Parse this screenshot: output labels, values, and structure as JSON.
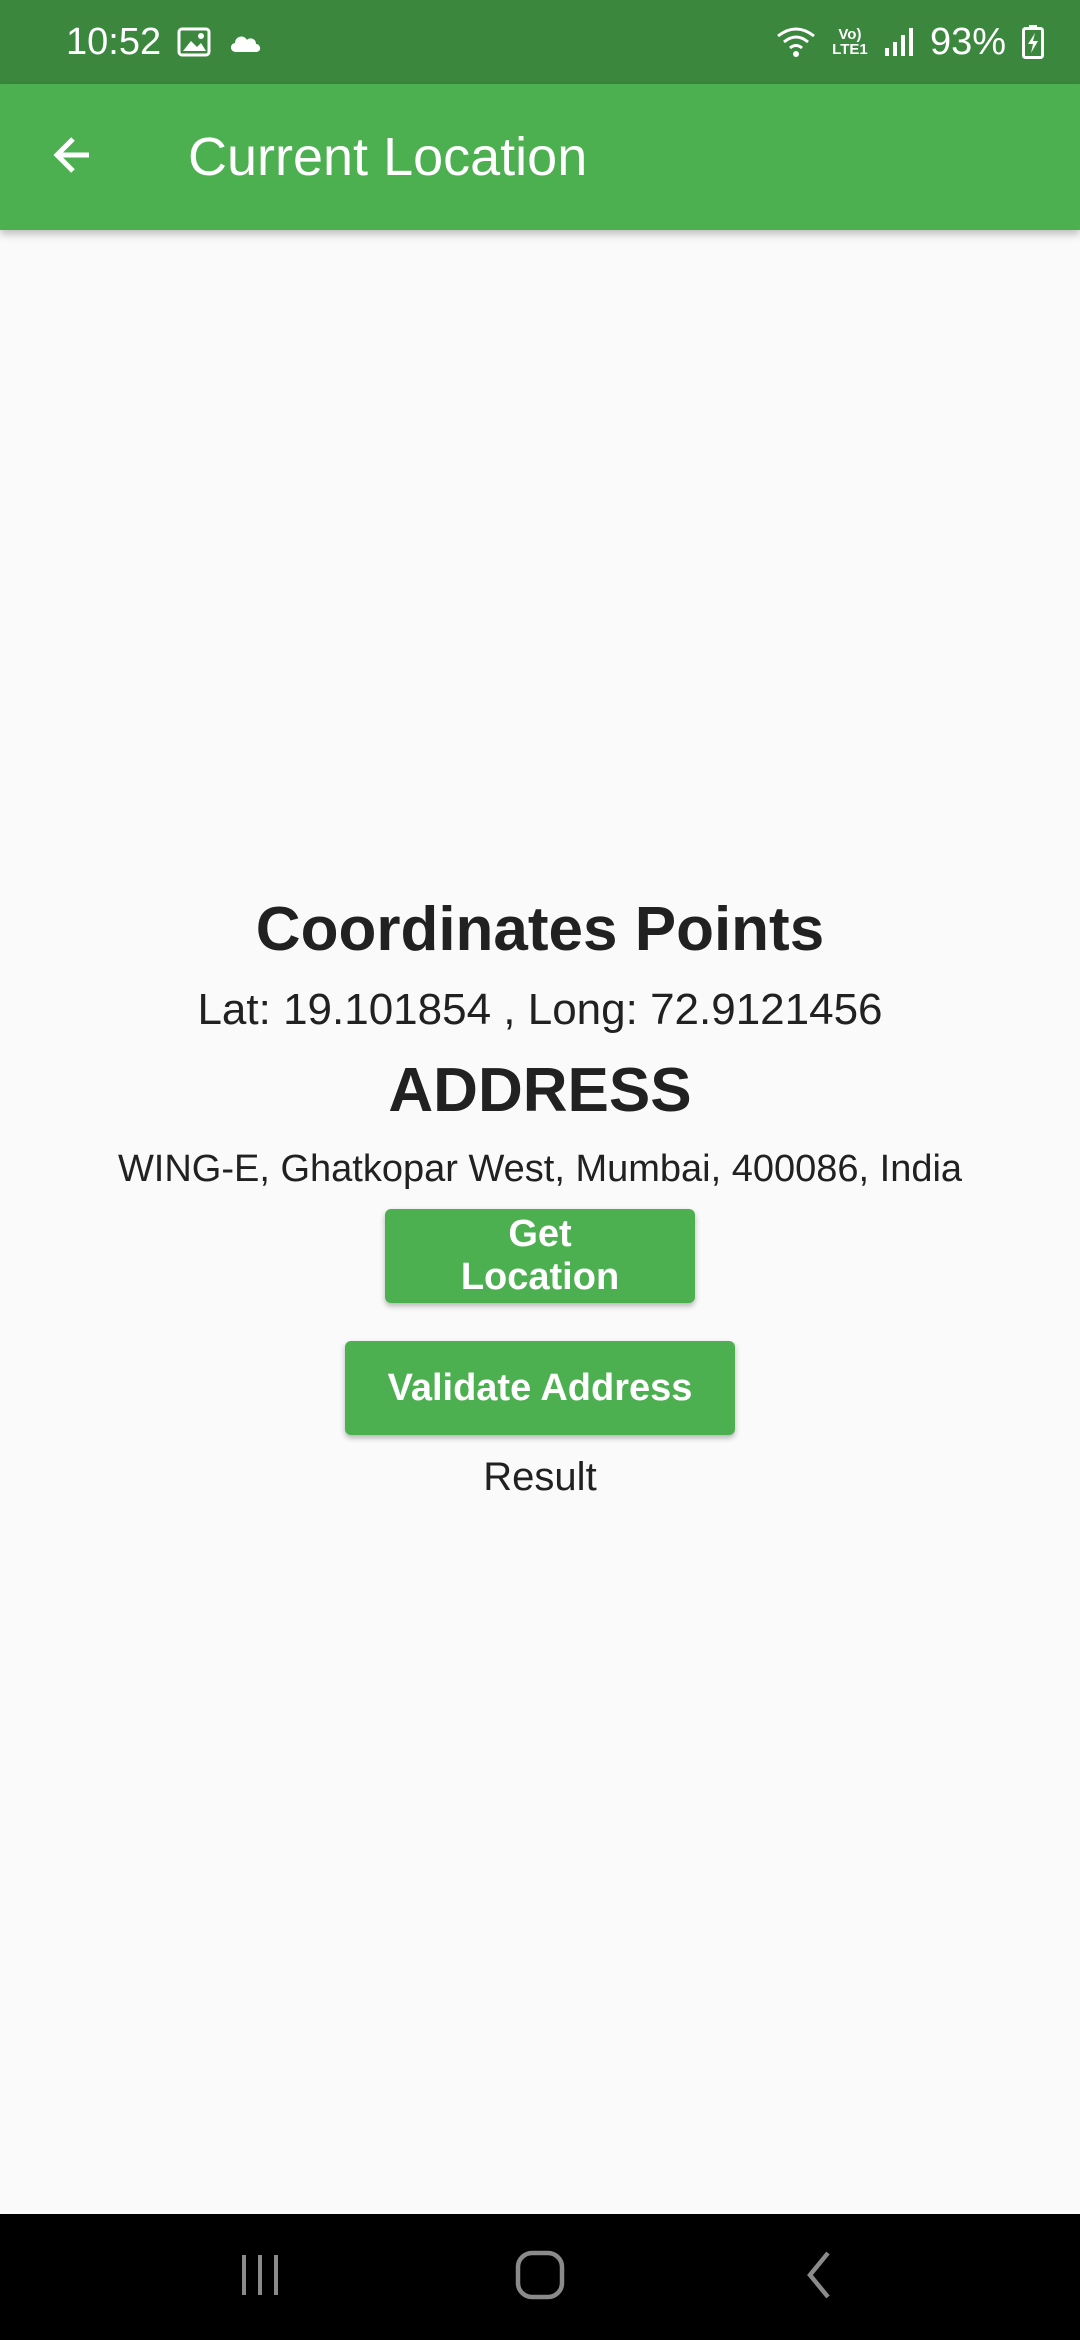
{
  "status_bar": {
    "time": "10:52",
    "battery_percent": "93%",
    "network_label": "Vo) LTE1",
    "icons": [
      "gallery-icon",
      "cloud-icon",
      "wifi-icon",
      "volte-icon",
      "signal-icon",
      "battery-charging-icon"
    ]
  },
  "app_bar": {
    "title": "Current Location",
    "back_icon": "arrow-back-icon"
  },
  "main": {
    "coords_heading": "Coordinates Points",
    "coords_text": "Lat: 19.101854 , Long: 72.9121456",
    "address_heading": "ADDRESS",
    "address_text": "WING-E, Ghatkopar West, Mumbai, 400086, India",
    "get_location_label": "Get Location",
    "validate_address_label": "Validate Address",
    "result_label": "Result"
  },
  "nav_bar": {
    "icons": [
      "recents-icon",
      "home-icon",
      "back-icon"
    ]
  },
  "colors": {
    "status_bar": "#3b873e",
    "primary": "#4caf50",
    "background": "#fafafa",
    "text": "#212121"
  }
}
